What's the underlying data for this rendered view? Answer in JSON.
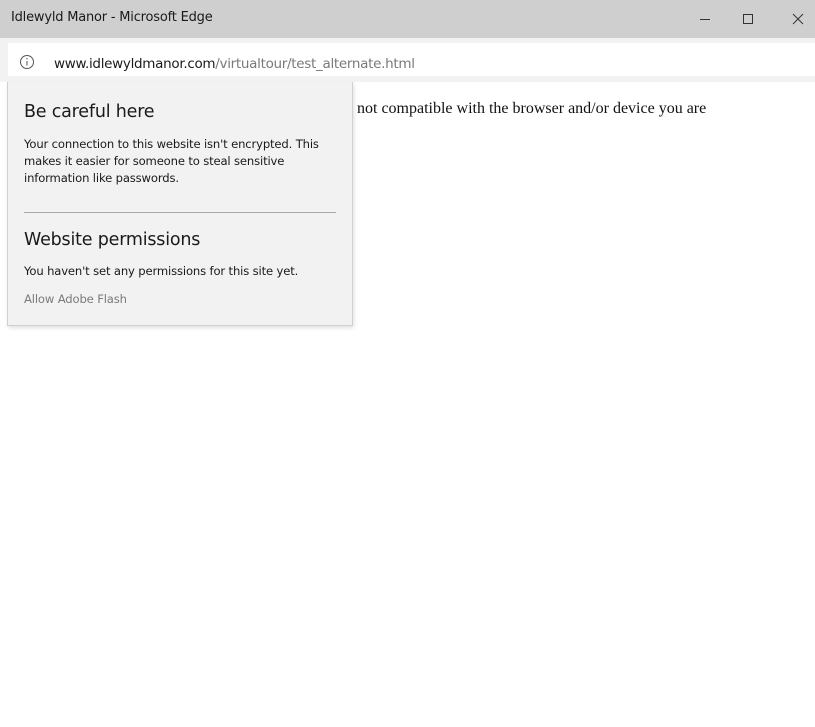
{
  "window": {
    "title": "Idlewyld Manor - Microsoft Edge",
    "controls": {
      "minimize_icon": "minimize-icon",
      "maximize_icon": "maximize-icon",
      "close_icon": "close-icon"
    }
  },
  "address_bar": {
    "info_icon": "info-icon",
    "url_domain": "www.idlewyldmanor.com",
    "url_path": "/virtualtour/test_alternate.html"
  },
  "page": {
    "message_fragment": "not compatible with the browser and/or device you are"
  },
  "site_info_flyout": {
    "security_heading": "Be careful here",
    "security_text": "Your connection to this website isn't encrypted. This makes it easier for someone to steal sensitive information like passwords.",
    "permissions_heading": "Website permissions",
    "permissions_text": "You haven't set any permissions for this site yet.",
    "flash_link": "Allow Adobe Flash"
  },
  "colors": {
    "titlebar_bg": "#cfcfcf",
    "flyout_bg": "#f2f2f2",
    "link_gray": "#7a7a7a",
    "text": "#1a1a1a"
  }
}
